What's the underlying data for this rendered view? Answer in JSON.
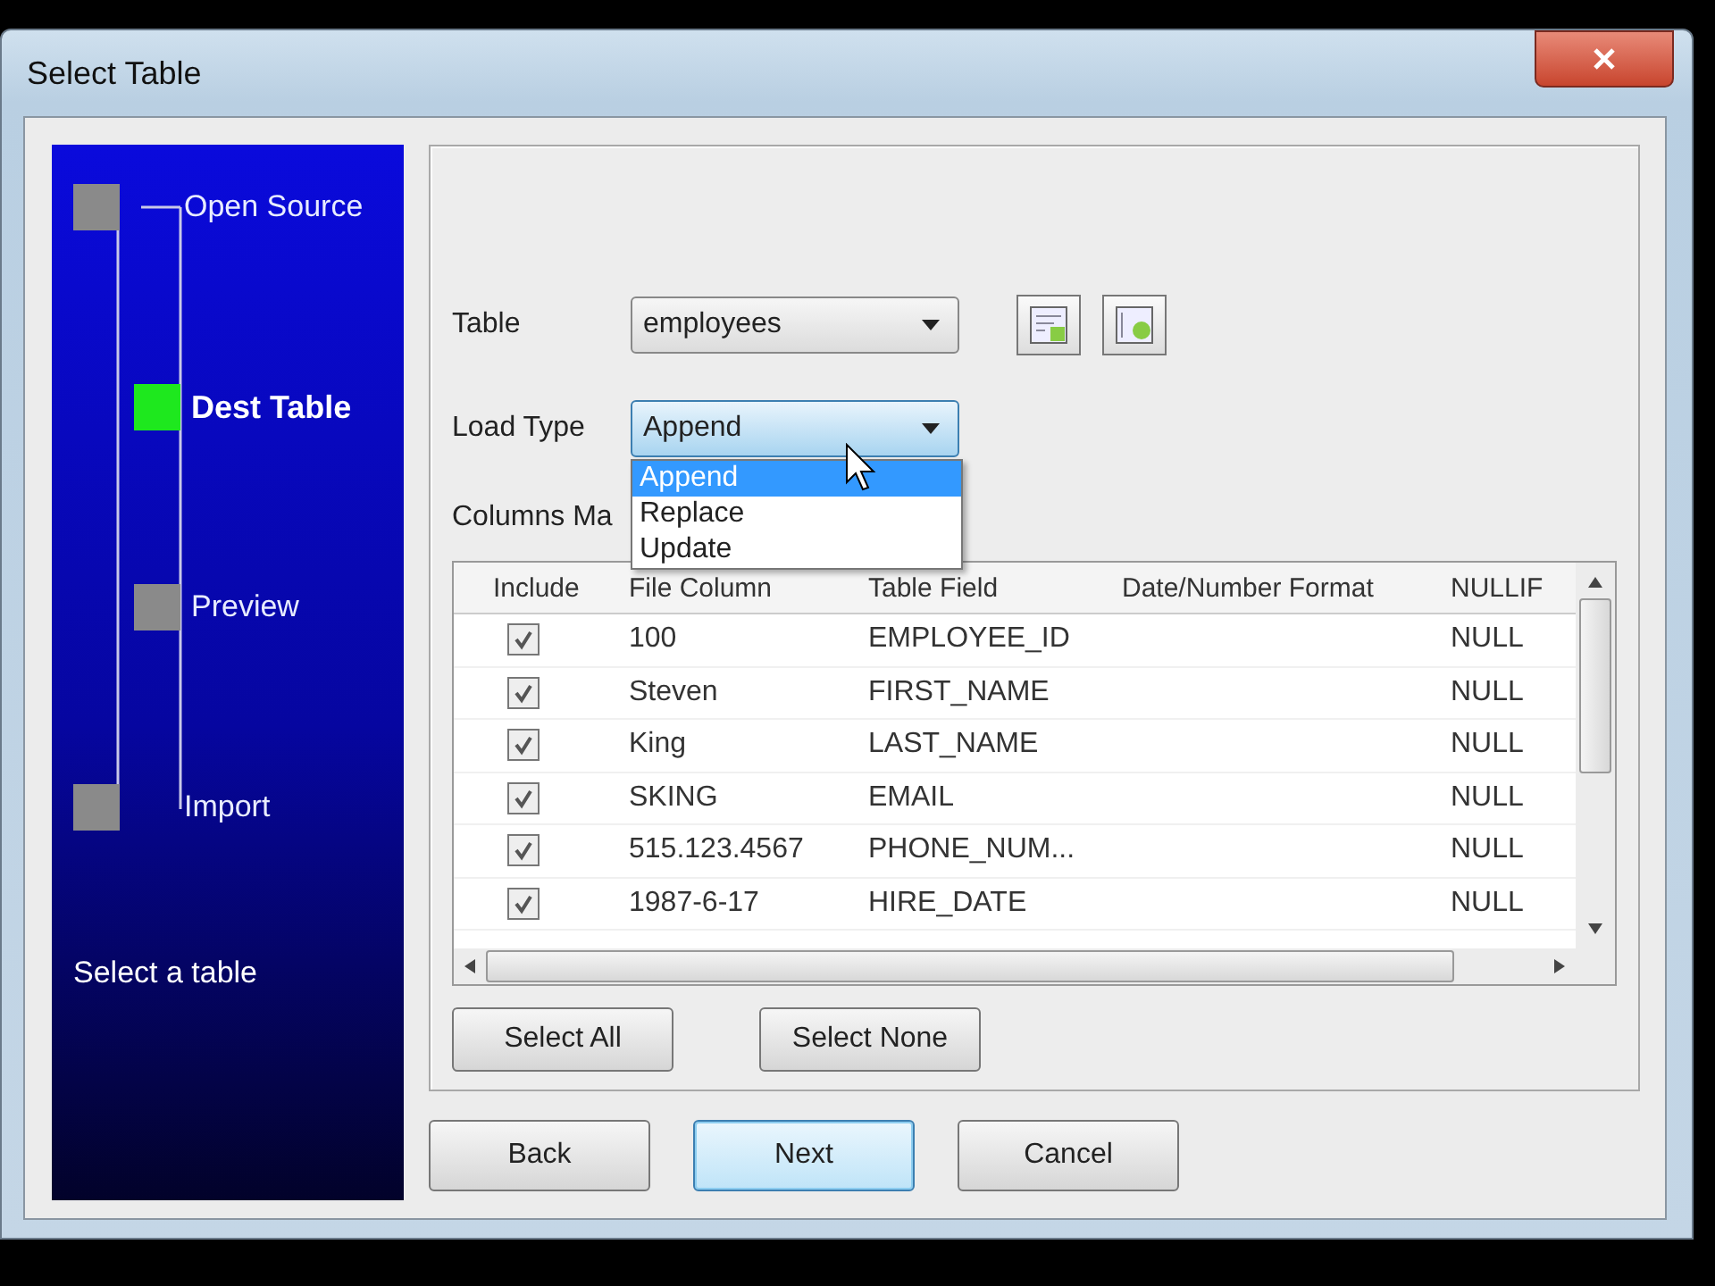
{
  "window": {
    "title": "Select Table"
  },
  "wizard": {
    "steps": [
      {
        "label": "Open Source",
        "kind": "outer",
        "current": false
      },
      {
        "label": "Dest Table",
        "kind": "inner",
        "current": true
      },
      {
        "label": "Preview",
        "kind": "inner",
        "current": false
      },
      {
        "label": "Import",
        "kind": "outer",
        "current": false
      }
    ],
    "hint": "Select a table"
  },
  "form": {
    "table": {
      "label": "Table",
      "value": "employees"
    },
    "load_type": {
      "label": "Load Type",
      "value": "Append",
      "expanded": true,
      "options": [
        {
          "label": "Append",
          "selected": true
        },
        {
          "label": "Replace",
          "selected": false
        },
        {
          "label": "Update",
          "selected": false
        }
      ]
    },
    "mapping_label": "Columns Ma"
  },
  "grid": {
    "columns": [
      "Include",
      "File Column",
      "Table Field",
      "Date/Number Format",
      "NULLIF"
    ],
    "rows": [
      {
        "include": true,
        "file_column": "100",
        "table_field": "EMPLOYEE_ID",
        "nullif": "NULL"
      },
      {
        "include": true,
        "file_column": "Steven",
        "table_field": "FIRST_NAME",
        "nullif": "NULL"
      },
      {
        "include": true,
        "file_column": "King",
        "table_field": "LAST_NAME",
        "nullif": "NULL"
      },
      {
        "include": true,
        "file_column": "SKING",
        "table_field": "EMAIL",
        "nullif": "NULL"
      },
      {
        "include": true,
        "file_column": "515.123.4567",
        "table_field": "PHONE_NUM...",
        "nullif": "NULL"
      },
      {
        "include": true,
        "file_column": "1987-6-17",
        "table_field": "HIRE_DATE",
        "nullif": "NULL"
      }
    ]
  },
  "selection_buttons": [
    "Select All",
    "Select None"
  ],
  "nav_buttons": [
    {
      "label": "Back",
      "default": false
    },
    {
      "label": "Next",
      "default": true
    },
    {
      "label": "Cancel",
      "default": false
    }
  ]
}
